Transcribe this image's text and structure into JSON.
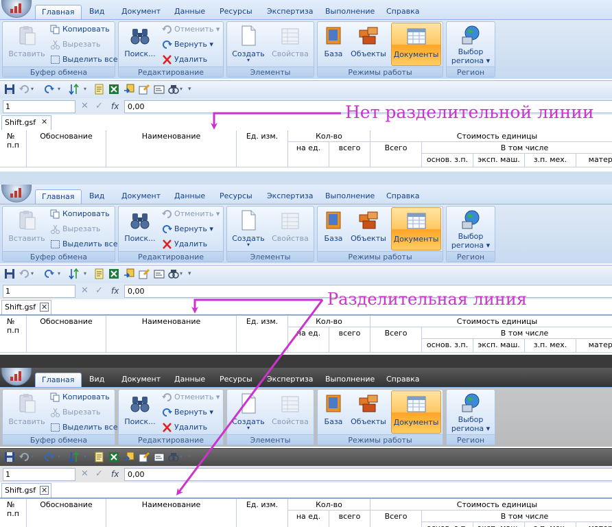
{
  "ribbon": {
    "tabs": [
      "Главная",
      "Вид",
      "Документ",
      "Данные",
      "Ресурсы",
      "Экспертиза",
      "Выполнение",
      "Справка"
    ],
    "clipboard": {
      "paste": "Вставить",
      "copy": "Копировать",
      "cut": "Вырезать",
      "select_all": "Выделить все",
      "group_label": "Буфер обмена"
    },
    "editing": {
      "find": "Поиск...",
      "undo": "Отменить",
      "redo": "Вернуть",
      "delete": "Удалить",
      "group_label": "Редактирование"
    },
    "elements": {
      "create": "Создать",
      "properties": "Свойства",
      "group_label": "Элементы"
    },
    "modes": {
      "base": "База",
      "objects": "Объекты",
      "documents": "Документы",
      "group_label": "Режимы работы"
    },
    "region": {
      "select_line1": "Выбор",
      "select_line2": "региона",
      "group_label": "Регион"
    }
  },
  "formula_bar": {
    "cell_ref": "1",
    "value": "0,00",
    "fx": "fx"
  },
  "document_tab": {
    "name": "Shift.gsf",
    "close": "✕"
  },
  "grid_headers": {
    "num": "№",
    "num2": "п.п",
    "basis": "Обоснование",
    "name": "Наименование",
    "unit": "Ед. изм.",
    "qty": "Кол-во",
    "per_unit": "на ед.",
    "total_qty": "всего",
    "unit_cost": "Стоимость единицы",
    "total": "Всего",
    "including": "В том числе",
    "basic_wage": "основ. з.п.",
    "machine_op": "эксп. маш.",
    "mech_wage": "з.п. мех.",
    "materials": "матер."
  },
  "annotations": {
    "no_line": "Нет разделительной линии",
    "with_line": "Разделительная линия"
  },
  "panels": [
    {
      "variant": "light",
      "separator": false
    },
    {
      "variant": "light",
      "separator": true
    },
    {
      "variant": "dark",
      "separator": true
    }
  ],
  "colors": {
    "annotation": "#cc33cc",
    "highlight": "#ffc763",
    "ribbon_blue": "#d8e6f7",
    "dark_title": "#3a3a3a"
  }
}
